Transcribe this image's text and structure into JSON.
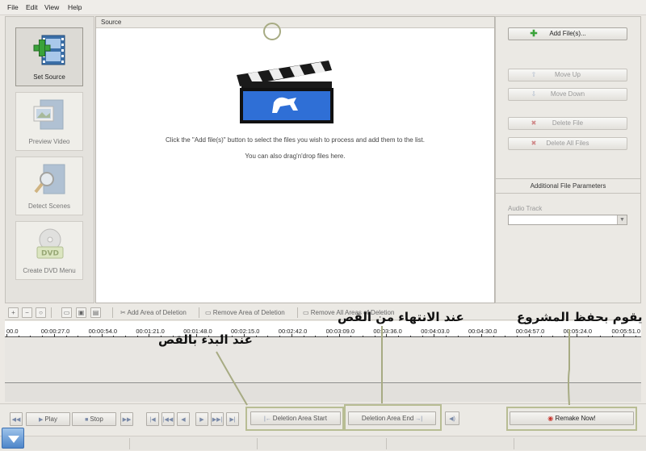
{
  "menu": [
    "File",
    "Edit",
    "View",
    "Help"
  ],
  "sidebar": [
    {
      "label": "Set Source",
      "icon": "film-add-icon",
      "active": true
    },
    {
      "label": "Preview Video",
      "icon": "film-picture-icon",
      "active": false
    },
    {
      "label": "Detect Scenes",
      "icon": "film-magnifier-icon",
      "active": false
    },
    {
      "label": "Create DVD Menu",
      "icon": "dvd-disc-icon",
      "active": false
    }
  ],
  "source": {
    "header": "Source",
    "instruction": "Click the \"Add file(s)\" button to select the files you wish to process and add them to the list.",
    "dragdrop": "You can also drag'n'drop files here."
  },
  "files": {
    "add": "Add File(s)...",
    "move_up": "Move Up",
    "move_down": "Move Down",
    "delete": "Delete File",
    "delete_all": "Delete All Files",
    "params_title": "Additional File Parameters",
    "audio_track_label": "Audio Track",
    "audio_track_value": ""
  },
  "toolbar": {
    "add_area": "Add Area of Deletion",
    "remove_area": "Remove Area of Deletion",
    "remove_all": "Remove All Areas of Deletion"
  },
  "ruler": [
    "00.0",
    "00:00:27.0",
    "00:00:54.0",
    "00:01:21.0",
    "00:01:48.0",
    "00:02:15.0",
    "00:02:42.0",
    "00:03:09.0",
    "00:03:36.0",
    "00:04:03.0",
    "00:04:30.0",
    "00:04:57.0",
    "00:05:24.0",
    "00:05:51.0"
  ],
  "controls": {
    "play": "Play",
    "stop": "Stop",
    "deletion_start": "Deletion Area Start",
    "deletion_end": "Deletion Area End",
    "remake": "Remake Now!"
  },
  "annotations": {
    "start": "عند البدء بالقص",
    "end": "عند الانتهاء من القص",
    "save": "يقوم بحفظ المشروع"
  },
  "colors": {
    "background": "#ece9e4",
    "annotation_box": "#b8bd94",
    "clapper_blue": "#2f6fd6",
    "add_plus_green": "#3aa33a"
  }
}
